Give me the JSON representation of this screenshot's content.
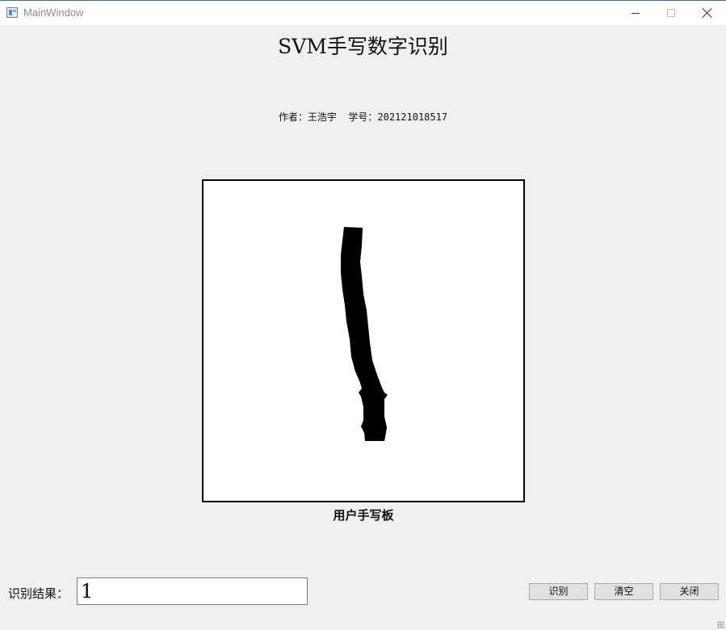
{
  "window": {
    "title": "MainWindow",
    "minimize_icon": "minimize-icon",
    "maximize_icon": "maximize-icon",
    "close_icon": "close-icon"
  },
  "header": {
    "title": "SVM手写数字识别",
    "author_line": "作者：王浩宇  学号：202121018517"
  },
  "canvas": {
    "label": "用户手写板",
    "background": "#ffffff",
    "stroke_color": "#000000"
  },
  "result": {
    "label": "识别结果：",
    "value": "1"
  },
  "buttons": {
    "recognize": "识别",
    "clear": "清空",
    "close": "关闭"
  }
}
